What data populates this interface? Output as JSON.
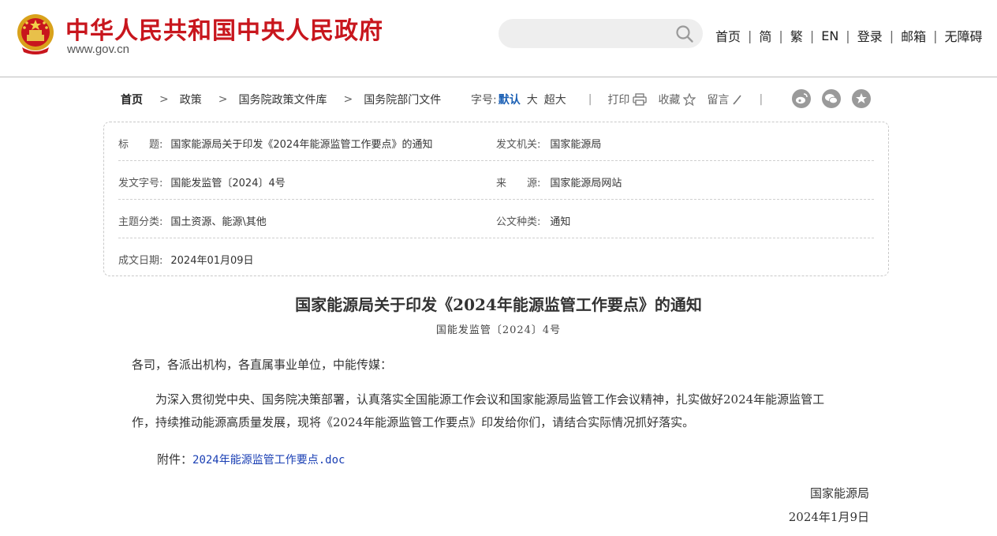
{
  "header": {
    "site_name": "中华人民共和国中央人民政府",
    "site_url": "www.gov.cn",
    "search_placeholder": "",
    "links": [
      "首页",
      "简",
      "繁",
      "EN",
      "登录",
      "邮箱",
      "无障碍"
    ]
  },
  "breadcrumb": [
    "首页",
    "政策",
    "国务院政策文件库",
    "国务院部门文件"
  ],
  "tools": {
    "font_label": "字号:",
    "font_sizes": [
      "默认",
      "大",
      "超大"
    ],
    "print": "打印",
    "favorite": "收藏",
    "comment": "留言",
    "share_icons": [
      "weibo-icon",
      "wechat-icon",
      "favorite-star-icon"
    ]
  },
  "info": {
    "title_label": "标　　题:",
    "title_value": "国家能源局关于印发《2024年能源监管工作要点》的通知",
    "issuer_label": "发文机关:",
    "issuer_value": "国家能源局",
    "docno_label": "发文字号:",
    "docno_value": "国能发监管〔2024〕4号",
    "source_label": "来　　源:",
    "source_value": "国家能源局网站",
    "topic_label": "主题分类:",
    "topic_value": "国土资源、能源\\其他",
    "type_label": "公文种类:",
    "type_value": "通知",
    "date_label": "成文日期:",
    "date_value": "2024年01月09日"
  },
  "article": {
    "title": "国家能源局关于印发《2024年能源监管工作要点》的通知",
    "doc_number": "国能发监管〔2024〕4号",
    "salutation": "各司，各派出机构，各直属事业单位，中能传媒：",
    "body_line1": "　　为深入贯彻党中央、国务院决策部署，认真落实全国能源工作会议和国家能源局监管工作会议精神，扎实做好2024年能源监管工",
    "body_line2": "作，持续推动能源高质量发展，现将《2024年能源监管工作要点》印发给你们，请结合实际情况抓好落实。",
    "attachment_label": "附件：",
    "attachment_link": "2024年能源监管工作要点.doc",
    "signature": "国家能源局",
    "sign_date": "2024年1月9日"
  },
  "colors": {
    "brand_red": "#c8161d",
    "link_blue": "#1a3fb4",
    "active_blue": "#1a5fb4"
  }
}
